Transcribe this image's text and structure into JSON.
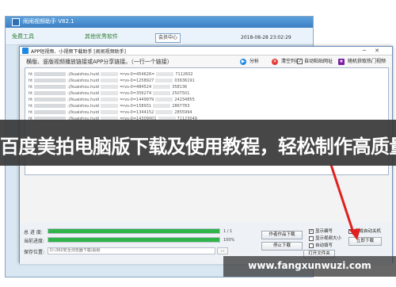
{
  "outer_window": {
    "title": "闹闹视频助手 V82.1",
    "menu_items": [
      "免费工具",
      "其他优秀软件"
    ],
    "member_center": "会员中心",
    "datetime": "2018-08-28 23:02:29"
  },
  "inner_window": {
    "title": "APP短视频、小视频下载助手 [闹闹视频助手]",
    "minimize": "─",
    "close": "✕"
  },
  "toolbar": {
    "hint": "横版、竖版视频播放链接或APP分享链接。（一行一个链接）",
    "analyze_label": "分析",
    "clear_label": "清空列表",
    "auto_paste_label": "自动粘贴网址",
    "auto_paste_checked": true,
    "random_label": "随机获取热门视频"
  },
  "url_list": [
    {
      "prefix": "ht",
      "path": "://kuaishou.huid",
      "mid": "=rvs-0=454626=",
      "tail": "7112602"
    },
    {
      "prefix": "ht",
      "path": "://kuaishou.huid",
      "mid": "=rvs-0=1258927",
      "tail": "03636191"
    },
    {
      "prefix": "ht",
      "path": "://kuaishou.huid",
      "mid": "=rvs-0=484524",
      "tail": "358136"
    },
    {
      "prefix": "ht",
      "path": "://kuaishou.huid",
      "mid": "=rvs-0=356274",
      "tail": "2507501"
    },
    {
      "prefix": "ht",
      "path": "://kuaishou.huid",
      "mid": "=rvs-0=1449979",
      "tail": "24234855"
    },
    {
      "prefix": "ht",
      "path": "://kuaishou.huid",
      "mid": "=rvs-0=158931",
      "tail": "2867783"
    },
    {
      "prefix": "ht",
      "path": "://kuaishou.huid",
      "mid": "=rvs-0=1344152",
      "tail": "2855994"
    },
    {
      "prefix": "ht",
      "path": "://kuaishou.huid",
      "mid": "=rvs-0=14309001",
      "tail": "71123049"
    }
  ],
  "banner": {
    "text": "百度美拍电脑版下载及使用教程，轻松制作高质量短视频"
  },
  "progress": {
    "total_label": "总 进 度:",
    "total_fraction": 1.0,
    "total_text": "1 / 1",
    "current_label": "当前进度:",
    "current_fraction": 1.0,
    "current_text": "100%",
    "save_label": "保存位置:",
    "save_path": "D:\\360安全浏览器下载\\视频",
    "browse_label": "..."
  },
  "actions": {
    "create_task_label": "作者作品下载",
    "download_label": "立即下载",
    "open_folder_label": "打开文件夹",
    "stop_label": "停止下载"
  },
  "options": {
    "show_number": {
      "label": "显示编号",
      "checked": true
    },
    "show_size": {
      "label": "显示视频大小",
      "checked": false
    },
    "auto_shutdown": {
      "label": "完成自动关机",
      "checked": false
    },
    "auto_fill": {
      "label": "自动填写",
      "checked": false
    }
  },
  "colors": {
    "progress_green": "#2fb44a",
    "arrow_red": "#e02020",
    "menu_green": "#2e7d32"
  },
  "watermark": {
    "text": "www.fangxunwuzi.com"
  }
}
